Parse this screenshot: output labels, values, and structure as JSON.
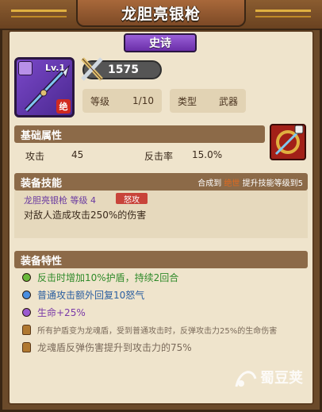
{
  "title": "龙胆亮银枪",
  "rarity": "史诗",
  "icon": {
    "level": "Lv.1",
    "badge": "绝"
  },
  "power": "1575",
  "level_label": "等级",
  "level_value": "1/10",
  "type_label": "类型",
  "type_value": "武器",
  "basic": {
    "header": "基础属性",
    "attack_label": "攻击",
    "attack_value": "45",
    "counter_label": "反击率",
    "counter_value": "15.0%"
  },
  "skill": {
    "header": "装备技能",
    "hint_prefix": "合成到",
    "hint_mid": "绝世",
    "hint_suffix": "提升技能等级到5",
    "name": "龙胆亮银枪 等级 4",
    "tag": "怒攻",
    "desc": "对敌人造成攻击250%的伤害"
  },
  "traits": {
    "header": "装备特性",
    "items": [
      {
        "text": "反击时增加10%护盾，持续2回合",
        "color": "#2f8a2a",
        "dot": "#6ab83a"
      },
      {
        "text": "普通攻击额外回复10怒气",
        "color": "#2a5ea0",
        "dot": "#4a8ee0"
      },
      {
        "text": "生命+25%",
        "color": "#7a3aa8",
        "dot": "#9a5ad0"
      },
      {
        "text": "所有护盾变为龙魂盾，受到普通攻击时，反弹攻击力25%的生命伤害",
        "color": "#7a6a5a",
        "locked": true
      },
      {
        "text": "龙魂盾反弹伤害提升到攻击力的75%",
        "color": "#7a6a5a",
        "locked": true
      }
    ]
  },
  "watermark": "蜀豆荚"
}
